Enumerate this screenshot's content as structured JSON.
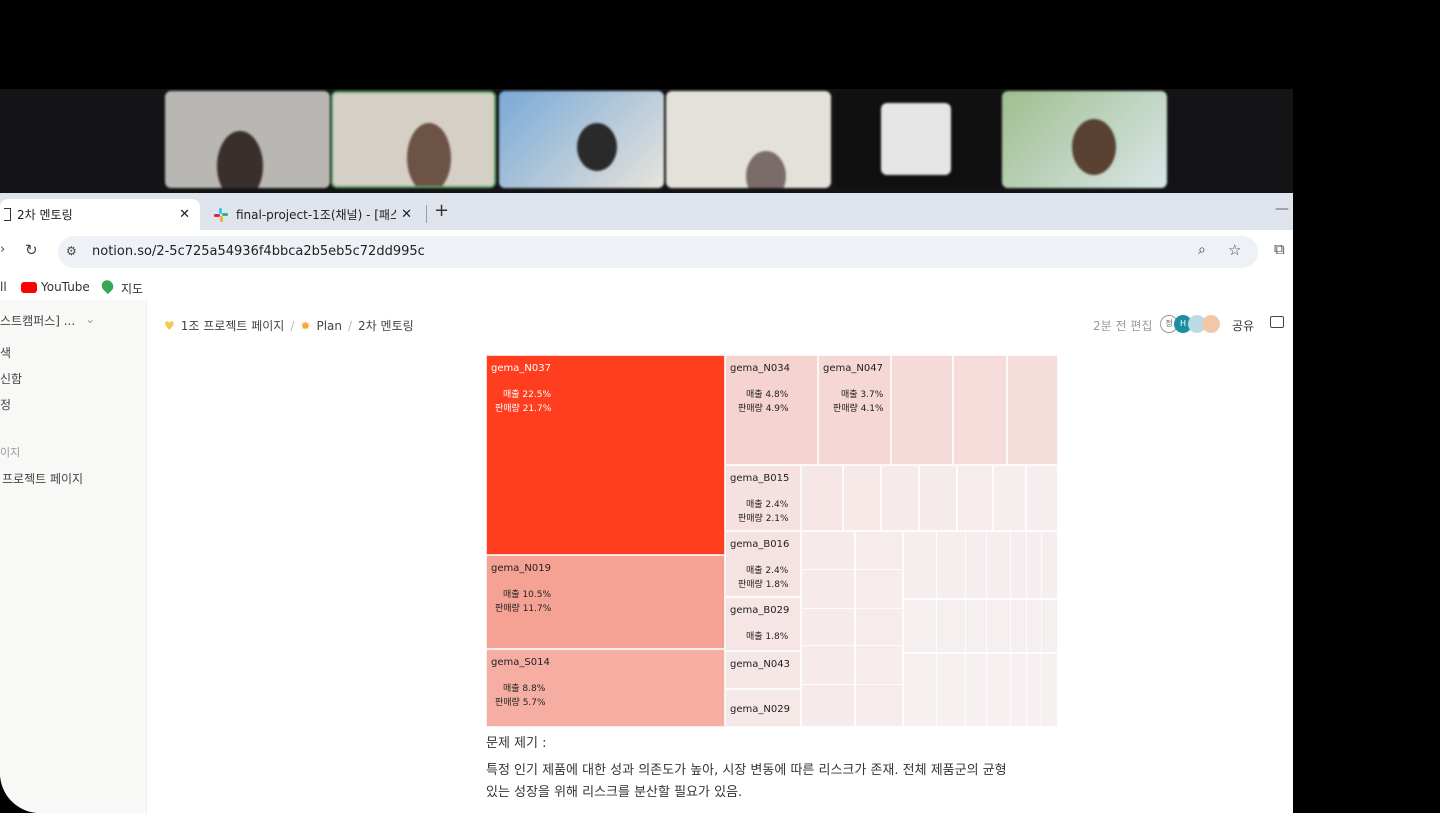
{
  "tabs": [
    {
      "label": "2차 멘토링",
      "active": true
    },
    {
      "label": "final-project-1조(채널) - [패스",
      "active": false
    }
  ],
  "address": {
    "url": "notion.so/2-5c725a54936f4bbca2b5eb5c72dd995c"
  },
  "bookmarks": [
    {
      "label": "ll"
    },
    {
      "label": "YouTube"
    },
    {
      "label": "지도"
    }
  ],
  "sidebar": {
    "workspace": "스트캠퍼스] ...",
    "items": [
      "색",
      "신함",
      "정"
    ],
    "section": "이지",
    "page": "프로젝트 페이지"
  },
  "breadcrumb": [
    "1조 프로젝트 페이지",
    "Plan",
    "2차 멘토링"
  ],
  "topbar": {
    "edited": "2분 전 편집",
    "share": "공유",
    "avatars": [
      "정",
      "H"
    ]
  },
  "treemap": {
    "cells": [
      {
        "name": "gema_N037",
        "l1": "매출 22.5%",
        "l2": "판매량 21.7%"
      },
      {
        "name": "gema_N019",
        "l1": "매출 10.5%",
        "l2": "판매량 11.7%"
      },
      {
        "name": "gema_S014",
        "l1": "매출 8.8%",
        "l2": "판매량 5.7%"
      },
      {
        "name": "gema_N034",
        "l1": "매출 4.8%",
        "l2": "판매량 4.9%"
      },
      {
        "name": "gema_N047",
        "l1": "매출 3.7%",
        "l2": "판매량 4.1%"
      },
      {
        "name": "gema_B015",
        "l1": "매출 2.4%",
        "l2": "판매량 2.1%"
      },
      {
        "name": "gema_B016",
        "l1": "매출 2.4%",
        "l2": "판매량 1.8%"
      },
      {
        "name": "gema_B029",
        "l1": "매출 1.8%",
        "l2": ""
      },
      {
        "name": "gema_N043",
        "l1": "",
        "l2": ""
      },
      {
        "name": "gema_N029",
        "l1": "",
        "l2": ""
      }
    ]
  },
  "body": {
    "heading": "문제 제기 :",
    "line1": "특정 인기 제품에 대한 성과 의존도가 높아, 시장 변동에 따른 리스크가 존재. 전체 제품군의 균형",
    "line2": "있는 성장을 위해 리스크를 분산할 필요가 있음."
  },
  "colors": {
    "accent": "#ff3d1f",
    "mid": "#f5a196",
    "light": "#f5d5d3",
    "lighter": "#f6e6e6"
  }
}
